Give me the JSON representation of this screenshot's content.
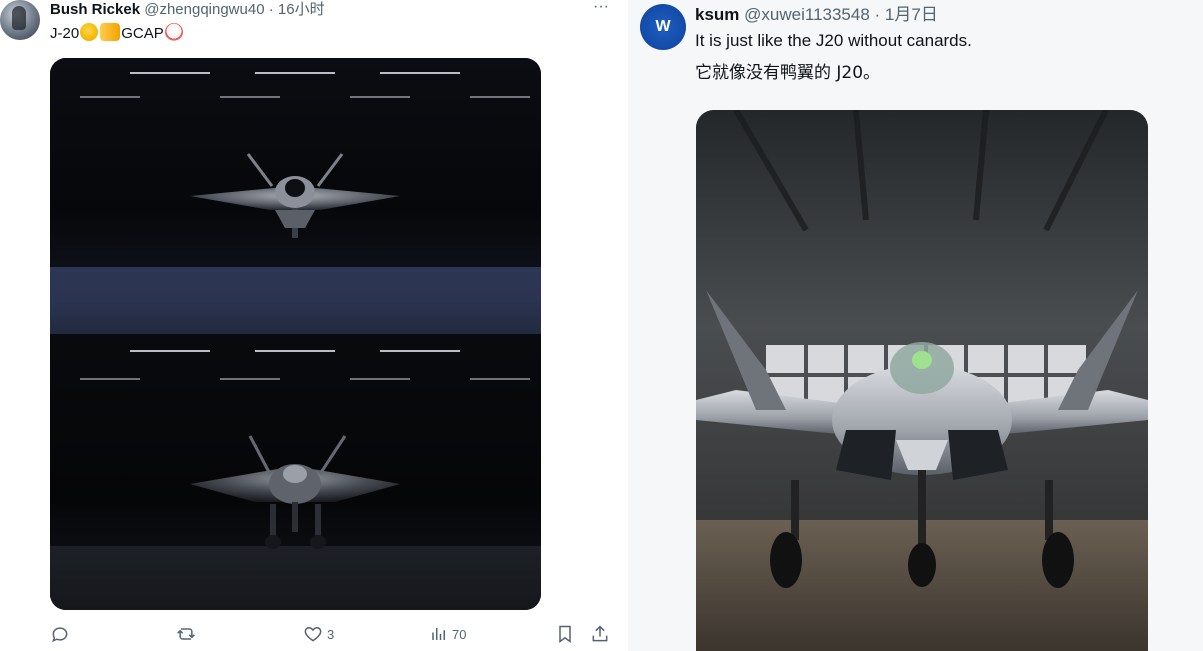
{
  "left_tweet": {
    "author": {
      "display_name": "Bush Rickek",
      "handle": "@zhengqingwu40",
      "separator": " · ",
      "time": "16小时"
    },
    "more_label": "···",
    "text_prefix": "J-20",
    "text_suffix": "GCAP",
    "emojis": [
      "rolling-on-floor-laughing",
      "backhand-pointing-right",
      "clown-face"
    ],
    "media": {
      "alt": "Two renders of a stealth fighter jet in a dark hangar, front view and angled view"
    },
    "actions": {
      "reply_count": "",
      "retweet_count": "",
      "like_count": "3",
      "views_count": "70"
    }
  },
  "right_tweet": {
    "author": {
      "avatar_letter": "W",
      "display_name": "ksum",
      "handle": "@xuwei1133548",
      "separator": " · ",
      "time": "1月7日"
    },
    "text_line_1": "It is just like the J20 without canards.",
    "text_line_2": "它就像没有鸭翼的 J20。",
    "media": {
      "alt": "Front view of a grey stealth fighter jet in a hangar"
    },
    "colors": {
      "avatar": "#134aa6"
    }
  },
  "colors": {
    "text_primary": "#0f1419",
    "text_secondary": "#536471"
  }
}
